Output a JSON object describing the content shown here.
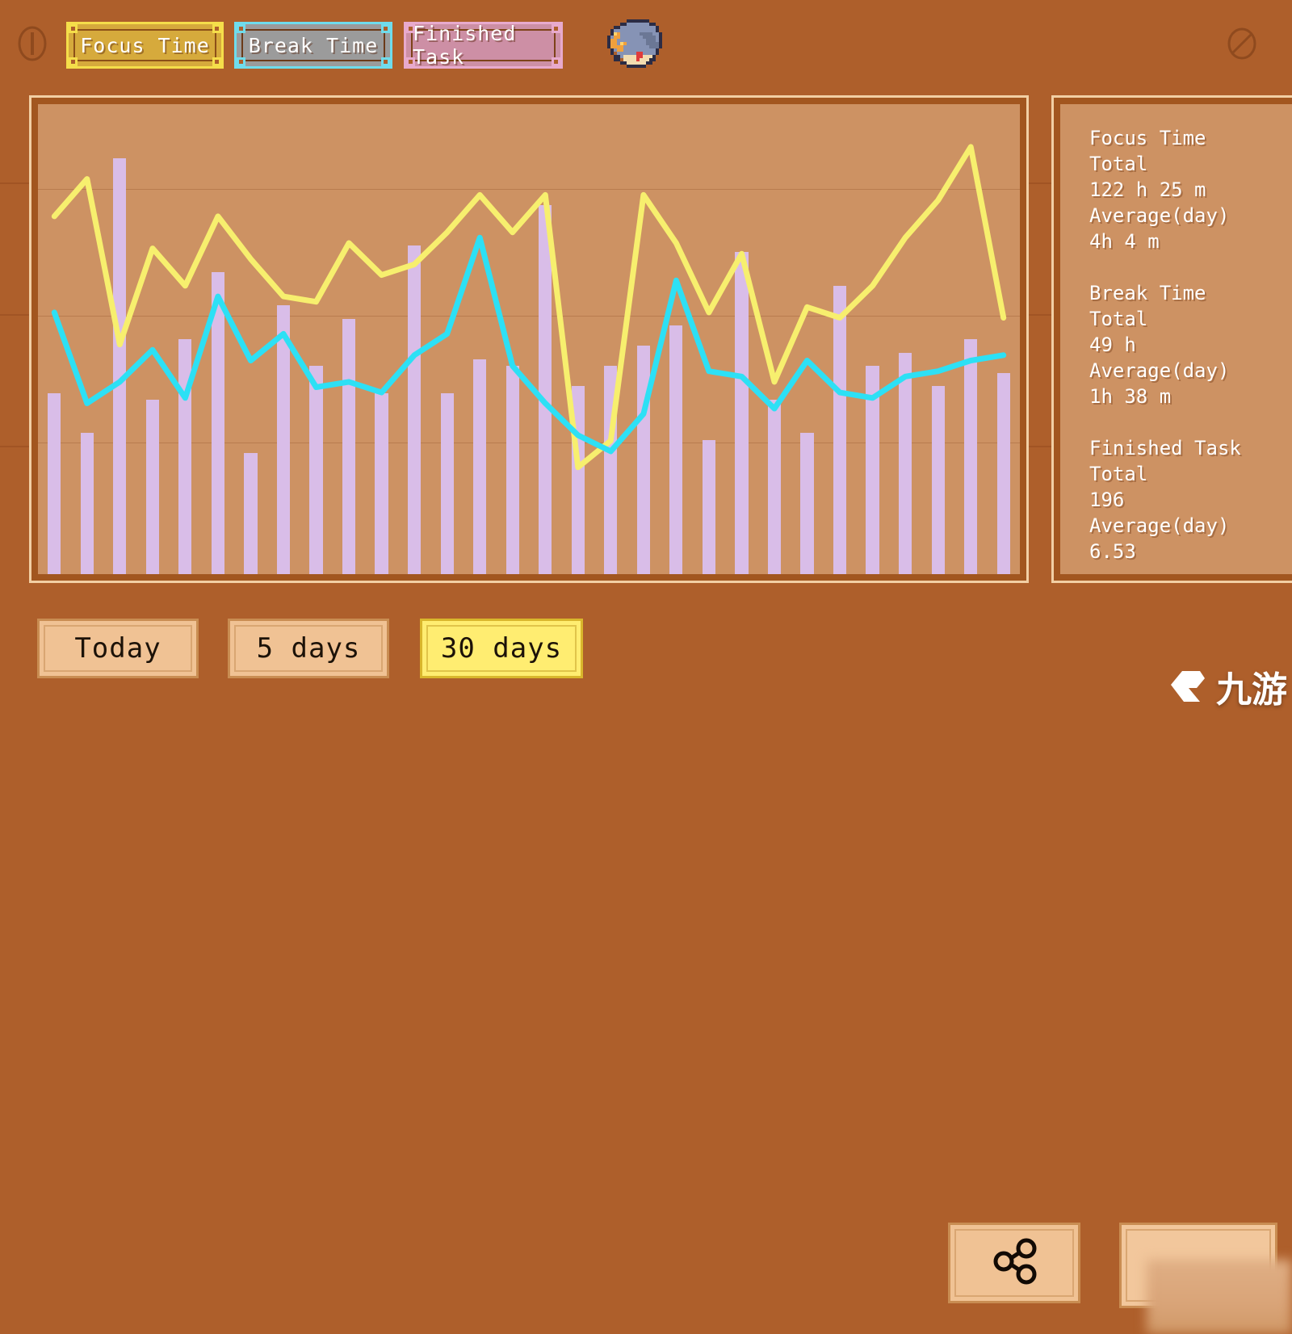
{
  "app": {
    "background_color": "#ae5f2b",
    "panel_fill_color": "#cd9263",
    "panel_border_color": "#f2cfa4"
  },
  "header": {
    "left_icon": "info-circle-icon",
    "right_icon": "no-entry-circle-icon",
    "book_icon": "book-icon",
    "legend": [
      {
        "label": "Focus Time",
        "key": "focus",
        "color": "#f5de4a",
        "fill": "#d6aa3c",
        "series_color": "#f7ef6e",
        "active": true
      },
      {
        "label": "Break Time",
        "key": "break",
        "color": "#6fdcec",
        "fill": "#9b9b9b",
        "series_color": "#2de0f5",
        "active": true
      },
      {
        "label": "Finished Task",
        "key": "task",
        "color": "#e8aacd",
        "fill": "#cd8fa5",
        "series_color": "#d9bde8",
        "active": true
      }
    ]
  },
  "stats": {
    "groups": [
      {
        "title": "Focus Time",
        "total_label": "Total",
        "total_value": "122 h 25 m",
        "average_label": "Average(day)",
        "average_value": "4h 4 m"
      },
      {
        "title": "Break Time",
        "total_label": "Total",
        "total_value": "49 h",
        "average_label": "Average(day)",
        "average_value": "1h 38 m"
      },
      {
        "title": "Finished Task",
        "total_label": "Total",
        "total_value": "196",
        "average_label": "Average(day)",
        "average_value": "6.53"
      }
    ]
  },
  "footer": {
    "ranges": [
      {
        "label": "Today",
        "selected": false
      },
      {
        "label": "5 days",
        "selected": false
      },
      {
        "label": "30 days",
        "selected": true
      }
    ],
    "share_icon": "share-icon",
    "locked_label": "",
    "watermark": "九游"
  },
  "chart_data": {
    "type": "bar",
    "title": "",
    "xlabel": "",
    "ylabel": "",
    "grid": true,
    "gridlines_y": [
      0.18,
      0.45,
      0.72
    ],
    "legend_position": "top",
    "x": [
      1,
      2,
      3,
      4,
      5,
      6,
      7,
      8,
      9,
      10,
      11,
      12,
      13,
      14,
      15,
      16,
      17,
      18,
      19,
      20,
      21,
      22,
      23,
      24,
      25,
      26,
      27,
      28,
      29,
      30
    ],
    "series": [
      {
        "name": "Finished Task",
        "render": "bar",
        "color": "#d9bde8",
        "values": [
          27,
          21,
          62,
          26,
          35,
          45,
          18,
          40,
          31,
          38,
          27,
          49,
          27,
          32,
          31,
          55,
          28,
          31,
          34,
          37,
          20,
          48,
          26,
          21,
          43,
          31,
          33,
          28,
          35,
          30
        ],
        "ymax": 70
      },
      {
        "name": "Focus Time",
        "render": "line",
        "color": "#f7ef6e",
        "values": [
          67,
          74,
          43,
          61,
          54,
          67,
          59,
          52,
          51,
          62,
          56,
          58,
          64,
          71,
          64,
          71,
          20,
          25,
          71,
          62,
          49,
          60,
          36,
          50,
          48,
          54,
          63,
          70,
          80,
          48
        ],
        "ymax": 88
      },
      {
        "name": "Break Time",
        "render": "line",
        "color": "#2de0f5",
        "values": [
          49,
          32,
          36,
          42,
          33,
          52,
          40,
          45,
          35,
          36,
          34,
          41,
          45,
          63,
          39,
          32,
          26,
          23,
          30,
          55,
          38,
          37,
          31,
          40,
          34,
          33,
          37,
          38,
          40,
          41
        ],
        "ymax": 88
      }
    ]
  }
}
